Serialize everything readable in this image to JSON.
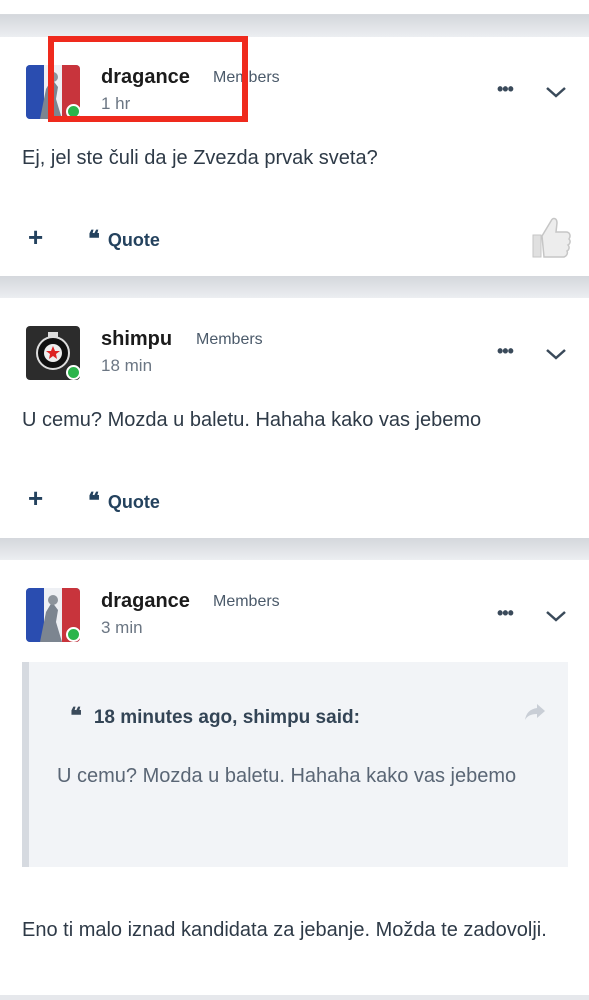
{
  "posts": [
    {
      "author": "dragance",
      "group": "Members",
      "time": "1 hr",
      "content": "Ej, jel ste čuli da je Zvezda prvak sveta?",
      "quote_label": "Quote",
      "plus_label": "+",
      "more_label": "•••",
      "online": true
    },
    {
      "author": "shimpu",
      "group": "Members",
      "time": "18 min",
      "content": "U cemu? Mozda u baletu. Hahaha kako vas jebemo",
      "quote_label": "Quote",
      "plus_label": "+",
      "more_label": "•••",
      "online": true
    },
    {
      "author": "dragance",
      "group": "Members",
      "time": "3 min",
      "quoted": {
        "header": "18 minutes ago, shimpu said:",
        "text": "U cemu? Mozda u baletu. Hahaha kako vas jebemo"
      },
      "content": "Eno ti malo iznad kandidata za jebanje. Možda te zadovolji.",
      "more_label": "•••",
      "online": true
    }
  ],
  "colors": {
    "accent": "#24425e",
    "online": "#2bb44b",
    "highlight": "#ef2a1d"
  }
}
